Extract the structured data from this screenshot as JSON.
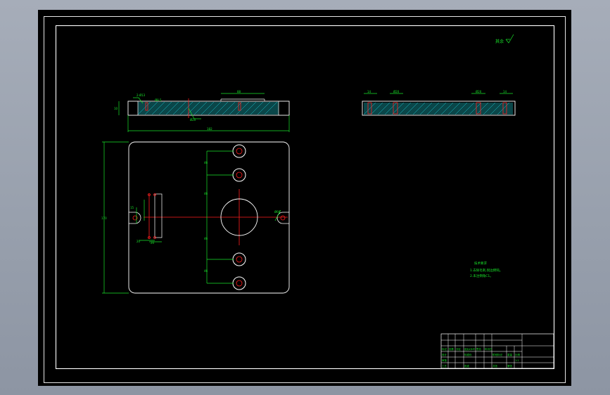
{
  "viewer": {
    "background": "#000000",
    "frame_color": "#ffffff",
    "dimension_color": "#19e62a",
    "centerline_color": "#ff1e1e",
    "hatch_color": "#1ec8d2"
  },
  "drawing": {
    "roughness_note": "其余",
    "top_view_dims": [
      "88",
      "2-Ø13",
      "Ø8.5",
      "Ø20",
      "182",
      "10"
    ],
    "side_view_dims": [
      "14",
      "Ø20",
      "Ø20",
      "14"
    ],
    "plan_view_dims": [
      "46",
      "46",
      "46",
      "46",
      "170",
      "15",
      "20",
      "20",
      "Ø66"
    ],
    "tech_requirements": {
      "title": "技术要求",
      "lines": [
        "1.去除毛刺,锐边倒钝。",
        "2.未注倒角C1。"
      ]
    }
  },
  "title_block": {
    "cells": [
      "标记",
      "处数",
      "分区",
      "更改文件号",
      "签名",
      "年月日",
      "设计",
      "标准化",
      "审核",
      "工艺",
      "批准",
      "阶段标记",
      "重量",
      "比例",
      "共张",
      "第张"
    ],
    "scale": "1:1"
  }
}
